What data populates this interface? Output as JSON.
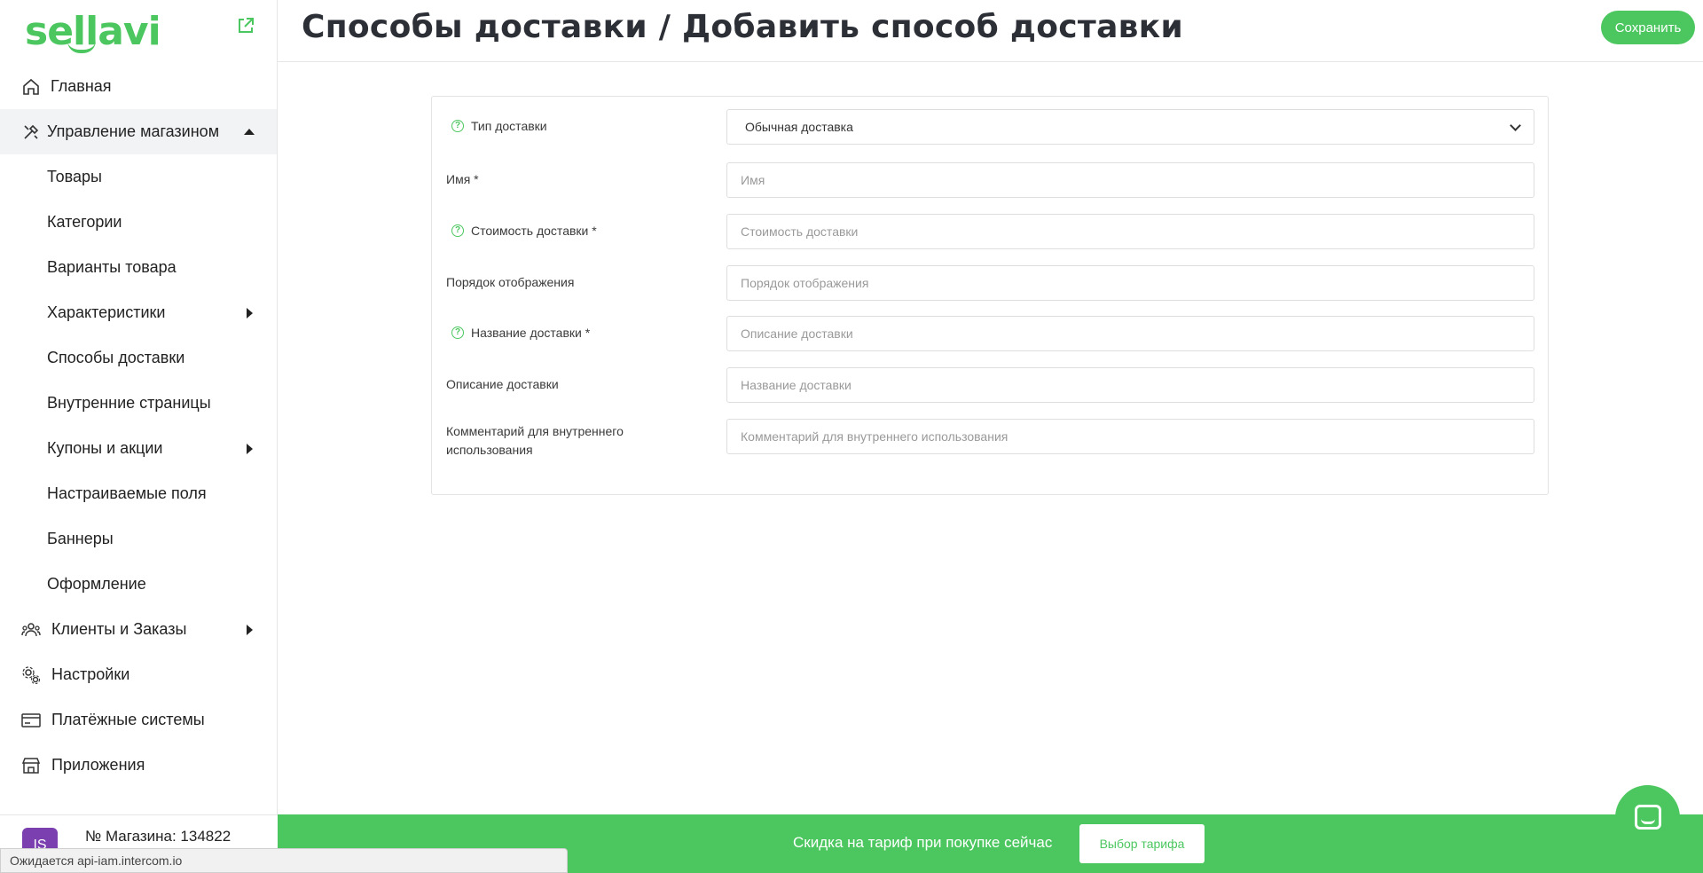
{
  "app": {
    "logo_text": "sellavi",
    "brand_color": "#4cc760"
  },
  "header": {
    "title": "Способы доставки / Добавить способ доставки",
    "save_label": "Сохранить"
  },
  "sidebar": {
    "items": [
      {
        "label": "Главная",
        "icon": "home-icon"
      },
      {
        "label": "Управление магазином",
        "icon": "tools-icon",
        "expanded": true
      },
      {
        "label": "Товары"
      },
      {
        "label": "Категории"
      },
      {
        "label": "Варианты товара"
      },
      {
        "label": "Характеристики"
      },
      {
        "label": "Способы доставки"
      },
      {
        "label": "Внутренние страницы"
      },
      {
        "label": "Купоны и акции"
      },
      {
        "label": "Настраиваемые поля"
      },
      {
        "label": "Баннеры"
      },
      {
        "label": "Оформление"
      },
      {
        "label": "Клиенты и Заказы",
        "icon": "users-icon"
      },
      {
        "label": "Настройки",
        "icon": "gear-icon"
      },
      {
        "label": "Платёжные системы",
        "icon": "payment-card-icon"
      },
      {
        "label": "Приложения",
        "icon": "store-icon"
      }
    ],
    "store": {
      "avatar_initials": "IS",
      "number_label": "№ Магазина: 134822"
    }
  },
  "form": {
    "delivery_type": {
      "label": "Тип доставки",
      "value": "Обычная доставка"
    },
    "name": {
      "label": "Имя *",
      "placeholder": "Имя"
    },
    "cost": {
      "label": "Стоимость доставки *",
      "placeholder": "Стоимость доставки"
    },
    "order": {
      "label": "Порядок отображения",
      "placeholder": "Порядок отображения"
    },
    "title": {
      "label": "Название доставки *",
      "placeholder": "Описание доставки"
    },
    "description": {
      "label": "Описание доставки",
      "placeholder": "Название доставки"
    },
    "comment": {
      "label_line1": "Комментарий для внутреннего",
      "label_line2": "использования",
      "placeholder": "Комментарий для внутреннего использования"
    }
  },
  "promo": {
    "text": "Скидка на тариф при покупке сейчас",
    "button_label": "Выбор тарифа"
  },
  "status_bar": {
    "text": "Ожидается api-iam.intercom.io"
  }
}
